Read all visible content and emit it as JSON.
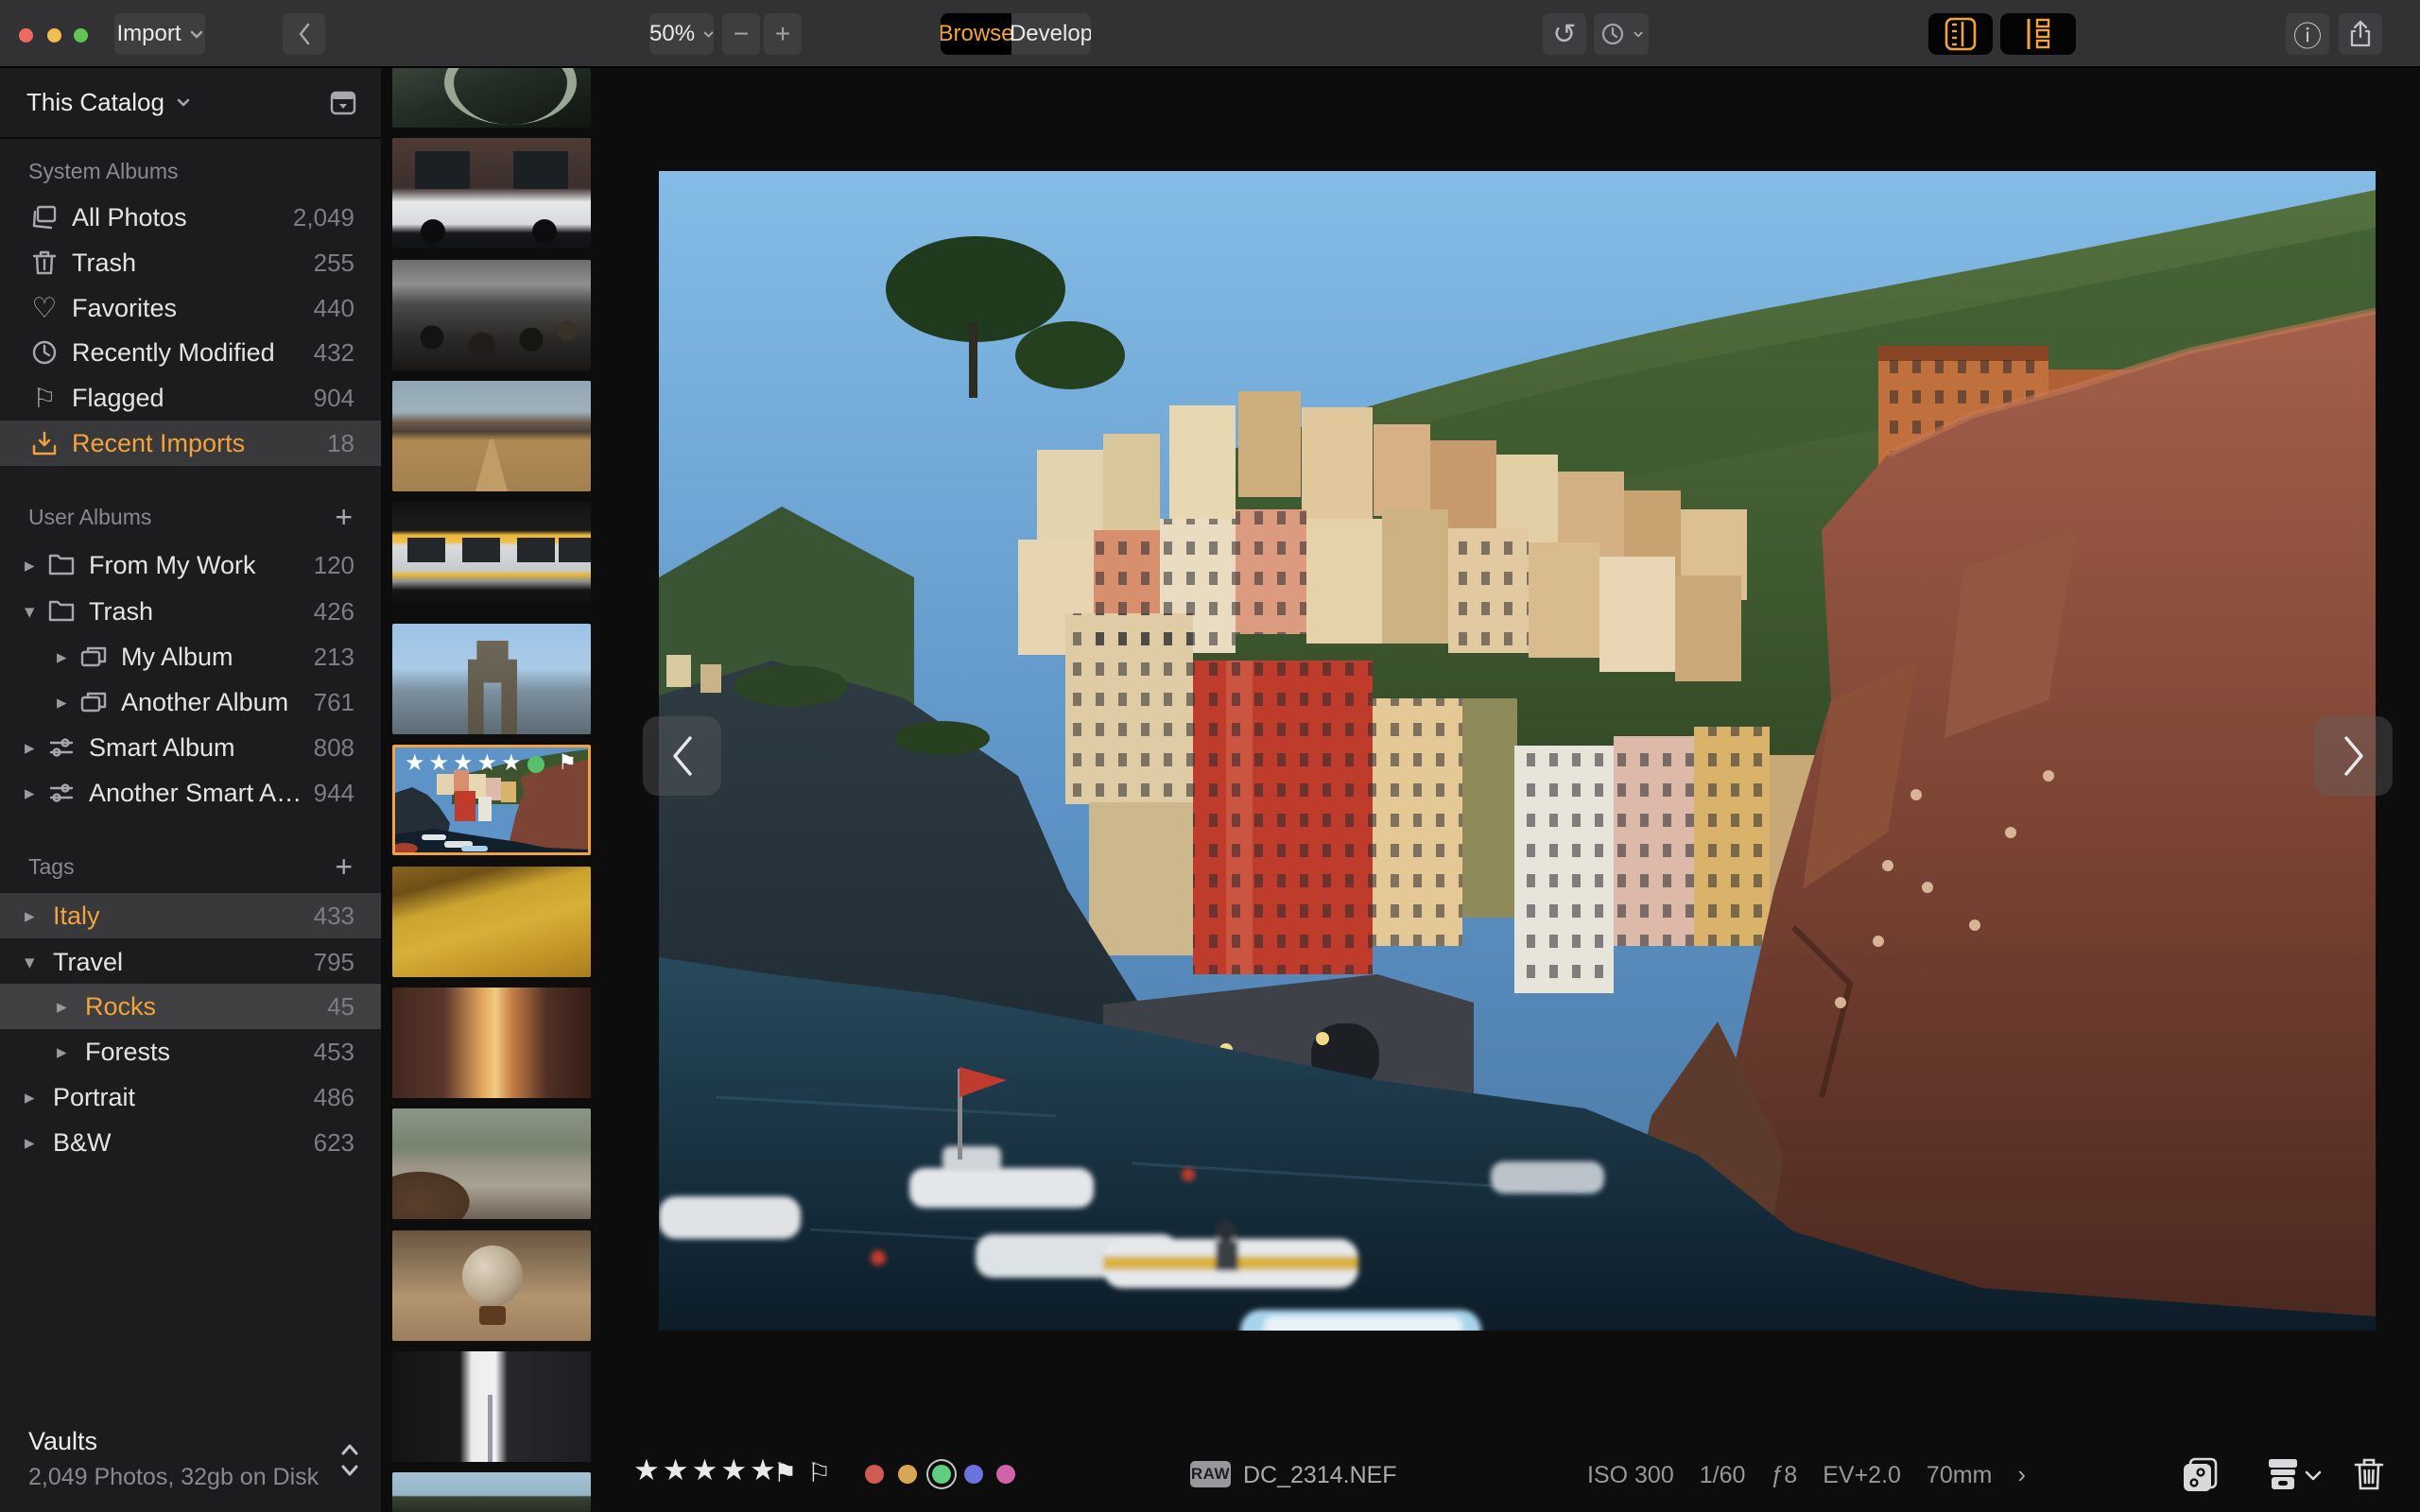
{
  "toolbar": {
    "import_label": "Import",
    "zoom_value": "50%",
    "tabs": [
      {
        "label": "Browse",
        "active": true
      },
      {
        "label": "Develop",
        "active": false
      }
    ]
  },
  "icons": {
    "tri_right": "▸",
    "tri_down": "▾",
    "plus": "+",
    "minus": "−",
    "undo": "↺",
    "info": "ⓘ",
    "heart": "♡",
    "flag_outline": "⚐",
    "flag_filled": "⚑",
    "chevron_right_small": "›"
  },
  "colors": {
    "accent": "#f2a33c",
    "label_red": "#cf5b52",
    "label_orange": "#d9a556",
    "label_green": "#5fcf7e",
    "label_blue": "#6b74dd",
    "label_pink": "#cf64a8"
  },
  "sidebar": {
    "catalog_label": "This Catalog",
    "system_albums": {
      "title": "System Albums",
      "items": [
        {
          "label": "All Photos",
          "count": "2,049",
          "icon": "photos-stack-icon"
        },
        {
          "label": "Trash",
          "count": "255",
          "icon": "trash-icon"
        },
        {
          "label": "Favorites",
          "count": "440",
          "icon": "heart-icon"
        },
        {
          "label": "Recently Modified",
          "count": "432",
          "icon": "clock-icon"
        },
        {
          "label": "Flagged",
          "count": "904",
          "icon": "flag-icon"
        },
        {
          "label": "Recent Imports",
          "count": "18",
          "icon": "import-tray-icon",
          "selected": true
        }
      ]
    },
    "user_albums": {
      "title": "User Albums",
      "items": [
        {
          "label": "From My Work",
          "count": "120",
          "icon": "folder-icon",
          "disclosure": "collapsed"
        },
        {
          "label": "Trash",
          "count": "426",
          "icon": "folder-icon",
          "disclosure": "expanded"
        },
        {
          "label": "My Album",
          "count": "213",
          "icon": "album-icon",
          "disclosure": "collapsed",
          "indent": 1
        },
        {
          "label": "Another Album",
          "count": "761",
          "icon": "album-icon",
          "disclosure": "collapsed",
          "indent": 1
        },
        {
          "label": "Smart Album",
          "count": "808",
          "icon": "smart-album-icon",
          "disclosure": "collapsed"
        },
        {
          "label": "Another Smart A…",
          "count": "944",
          "icon": "smart-album-icon",
          "disclosure": "collapsed"
        }
      ]
    },
    "tags": {
      "title": "Tags",
      "items": [
        {
          "label": "Italy",
          "count": "433",
          "disclosure": "collapsed",
          "selected": true
        },
        {
          "label": "Travel",
          "count": "795",
          "disclosure": "expanded"
        },
        {
          "label": "Rocks",
          "count": "45",
          "disclosure": "collapsed",
          "selected": true,
          "indent": 1
        },
        {
          "label": "Forests",
          "count": "453",
          "disclosure": "collapsed",
          "indent": 1
        },
        {
          "label": "Portrait",
          "count": "486",
          "disclosure": "collapsed"
        },
        {
          "label": "B&W",
          "count": "623",
          "disclosure": "collapsed"
        }
      ]
    },
    "vaults": {
      "label": "Vaults",
      "summary": "2,049 Photos, 32gb on Disk"
    }
  },
  "filmstrip": {
    "thumbs": [
      {
        "subject": "stone-arch-bridge"
      },
      {
        "subject": "white-car-brick-building"
      },
      {
        "subject": "train-platform-crowd"
      },
      {
        "subject": "desert-road-mountains"
      },
      {
        "subject": "yellow-striped-train"
      },
      {
        "subject": "brooklyn-bridge-tower"
      },
      {
        "subject": "riomaggiore-harbor",
        "selected": true
      },
      {
        "subject": "golden-dunes-footprints"
      },
      {
        "subject": "brick-warehouse-sunset"
      },
      {
        "subject": "arm-out-car-window"
      },
      {
        "subject": "hand-on-globe"
      },
      {
        "subject": "skyscrapers-tower"
      },
      {
        "subject": "hillside-sky-partial"
      }
    ],
    "selected_overlay": {
      "stars": "★★★★★",
      "color_label": "green",
      "flag": "⚑"
    }
  },
  "viewer": {
    "photo_subject": "riomaggiore-cinque-terre-harbor"
  },
  "bottombar": {
    "stars": "★★★★★",
    "format_badge": "RAW",
    "filename": "DC_2314.NEF",
    "exif": [
      "ISO 300",
      "1/60",
      "ƒ8",
      "EV+2.0",
      "70mm"
    ]
  }
}
